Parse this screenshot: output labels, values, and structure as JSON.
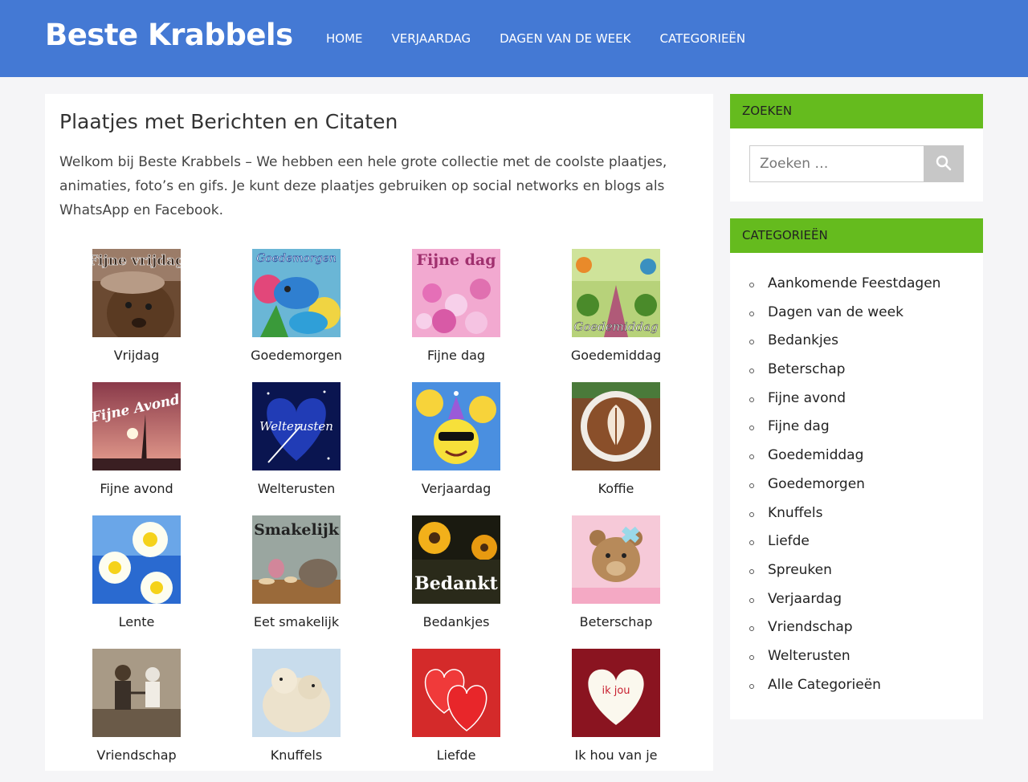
{
  "site": {
    "logo": "Beste Krabbels"
  },
  "nav": [
    "HOME",
    "VERJAARDAG",
    "DAGEN VAN DE WEEK",
    "CATEGORIEËN"
  ],
  "main": {
    "title": "Plaatjes met Berichten en Citaten",
    "intro": "Welkom bij Beste Krabbels – We hebben een hele grote collectie met de coolste plaatjes, animaties, foto’s en gifs. Je kunt deze plaatjes gebruiken op social networks en blogs als WhatsApp en Facebook.",
    "tiles": [
      {
        "caption": "Vrijdag",
        "image_text": "Fijne vrijdag"
      },
      {
        "caption": "Goedemorgen",
        "image_text": "Goedemorgen"
      },
      {
        "caption": "Fijne dag",
        "image_text": "Fijne dag"
      },
      {
        "caption": "Goedemiddag",
        "image_text": "Goedemiddag"
      },
      {
        "caption": "Fijne avond",
        "image_text": "Fijne Avond"
      },
      {
        "caption": "Welterusten",
        "image_text": "Welterusten"
      },
      {
        "caption": "Verjaardag",
        "image_text": ""
      },
      {
        "caption": "Koffie",
        "image_text": ""
      },
      {
        "caption": "Lente",
        "image_text": ""
      },
      {
        "caption": "Eet smakelijk",
        "image_text": "Smakelijk"
      },
      {
        "caption": "Bedankjes",
        "image_text": "Bedankt"
      },
      {
        "caption": "Beterschap",
        "image_text": ""
      },
      {
        "caption": "Vriendschap",
        "image_text": ""
      },
      {
        "caption": "Knuffels",
        "image_text": ""
      },
      {
        "caption": "Liefde",
        "image_text": ""
      },
      {
        "caption": "Ik hou van je",
        "image_text": "ik jou"
      }
    ]
  },
  "sidebar": {
    "search": {
      "title": "ZOEKEN",
      "placeholder": "Zoeken …",
      "button_icon": "search-icon"
    },
    "categories": {
      "title": "CATEGORIEËN",
      "items": [
        "Aankomende Feestdagen",
        "Dagen van de week",
        "Bedankjes",
        "Beterschap",
        "Fijne avond",
        "Fijne dag",
        "Goedemiddag",
        "Goedemorgen",
        "Knuffels",
        "Liefde",
        "Spreuken",
        "Verjaardag",
        "Vriendschap",
        "Welterusten",
        "Alle Categorieën"
      ]
    }
  },
  "colors": {
    "header": "#4479d4",
    "widget_title": "#65bb1e",
    "search_button": "#c7c7c7"
  }
}
